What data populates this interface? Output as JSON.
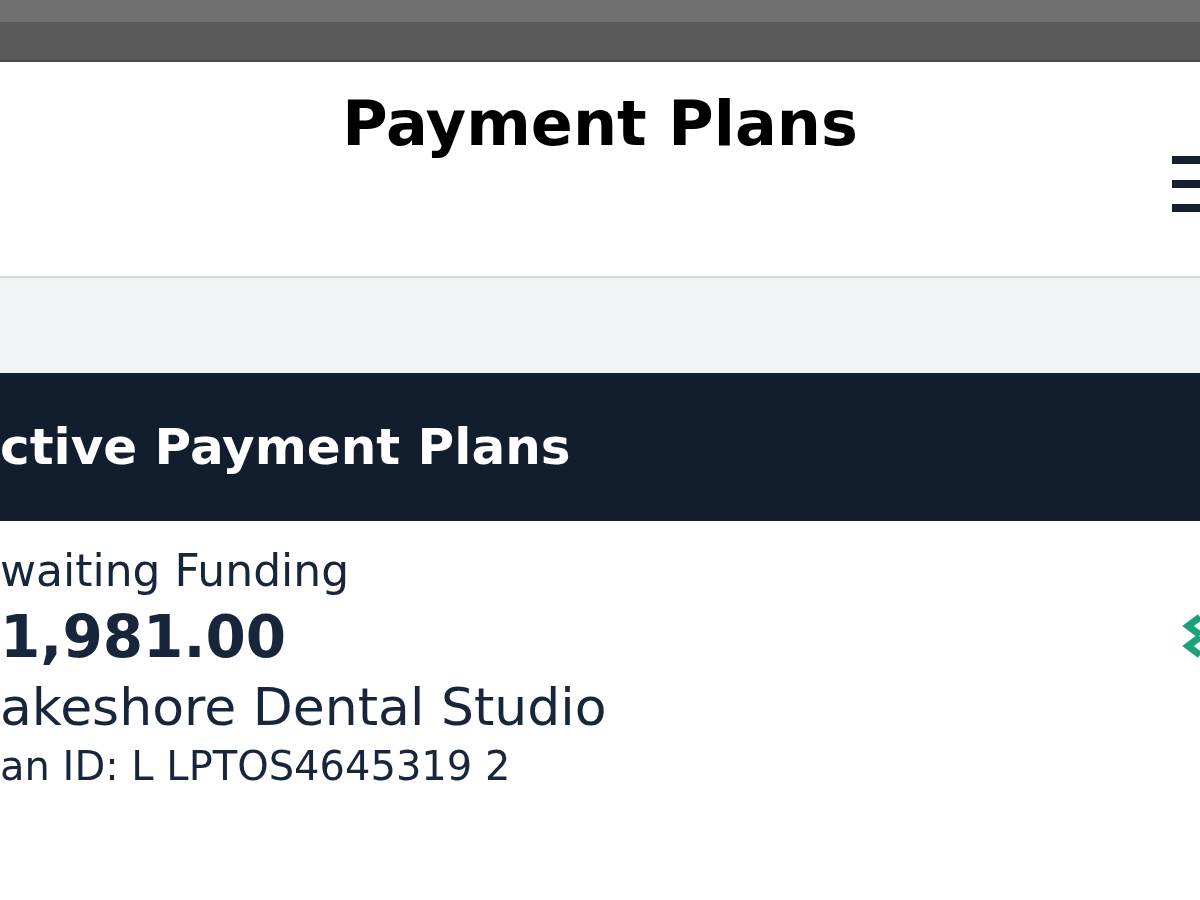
{
  "header": {
    "title": "Payment Plans"
  },
  "section": {
    "title": "ctive Payment Plans"
  },
  "plan": {
    "status": "waiting Funding",
    "amount": "1,981.00",
    "provider": "akeshore Dental Studio",
    "plan_id": "an ID: L LPTOS4645319 2"
  }
}
